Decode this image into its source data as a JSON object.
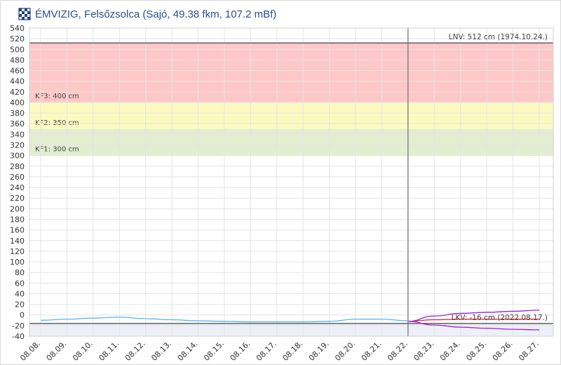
{
  "header": {
    "title": "ÉMVIZIG, Felsőzsolca (Sajó, 49.38 fkm, 107.2 mBf)",
    "logo_icon": "checkered-shield-icon"
  },
  "colors": {
    "kf3_band": "#ffc8c8",
    "kf2_band": "#fdfac0",
    "kf1_band": "#e3eed0",
    "below_lkv_band": "#eef0f8",
    "observed_line": "#5ab4ea",
    "forecast_line": "#9b1fe0",
    "forecast_center": "#cc2233",
    "reference_line": "#555555",
    "grid": "#e4e4e4"
  },
  "chart_data": {
    "type": "line",
    "title": "ÉMVIZIG, Felsőzsolca (Sajó, 49.38 fkm, 107.2 mBf)",
    "xlabel": "",
    "ylabel": "",
    "ylim": [
      -40,
      540
    ],
    "y_ticks": [
      -40,
      -20,
      0,
      20,
      40,
      60,
      80,
      100,
      120,
      140,
      160,
      180,
      200,
      220,
      240,
      260,
      280,
      300,
      320,
      340,
      360,
      380,
      400,
      420,
      440,
      460,
      480,
      500,
      520,
      540
    ],
    "y_tick_labels": [
      "-40",
      "-20",
      "0",
      "20",
      "40",
      "60",
      "80",
      "100",
      "120",
      "140",
      "160",
      "180",
      "200",
      "220",
      "240",
      "260",
      "280",
      "300",
      "320",
      "340",
      "360",
      "380",
      "400",
      "420",
      "440",
      "460",
      "480",
      "500",
      "520",
      "540"
    ],
    "x_labels": [
      "08.08.",
      "08.09.",
      "08.10.",
      "08.11.",
      "08.12.",
      "08.13.",
      "08.14.",
      "08.15.",
      "08.16.",
      "08.17.",
      "08.18.",
      "08.19.",
      "08.20.",
      "08.21.",
      "08.22.",
      "08.23.",
      "08.24.",
      "08.25.",
      "08.26.",
      "08.27."
    ],
    "grid": true,
    "bands": [
      {
        "name": "KF3",
        "label": "KF3: 400 cm",
        "from": 400,
        "to": 512
      },
      {
        "name": "KF2",
        "label": "KF2: 350 cm",
        "from": 350,
        "to": 400
      },
      {
        "name": "KF1",
        "label": "KF1: 300 cm",
        "from": 300,
        "to": 350
      }
    ],
    "reference_lines": [
      {
        "label": "LNV: 512 cm (1974.10.24.)",
        "value": 512
      },
      {
        "label": "LKV: -16 cm (2022.08.17.)",
        "value": -16
      }
    ],
    "now_marker": "08.22.",
    "series": [
      {
        "kind": "observed",
        "x": [
          "08.08.",
          "08.09.",
          "08.10.",
          "08.11.",
          "08.12.",
          "08.13.",
          "08.14.",
          "08.15.",
          "08.16.",
          "08.17.",
          "08.18.",
          "08.19.",
          "08.20.",
          "08.21.",
          "08.22."
        ],
        "values": [
          -10,
          -8,
          -6,
          -4,
          -7,
          -9,
          -11,
          -12,
          -13,
          -13,
          -13,
          -12,
          -8,
          -8,
          -11
        ]
      },
      {
        "kind": "forecast-upper",
        "x": [
          "08.22.",
          "08.23.",
          "08.24.",
          "08.25.",
          "08.26.",
          "08.27."
        ],
        "values": [
          -12,
          -2,
          3,
          5,
          7,
          9
        ]
      },
      {
        "kind": "forecast-center",
        "x": [
          "08.22.",
          "08.23.",
          "08.24.",
          "08.25.",
          "08.26.",
          "08.27."
        ],
        "values": [
          -12,
          -9,
          -8,
          -8,
          -8,
          -8
        ]
      },
      {
        "kind": "forecast-lower",
        "x": [
          "08.22.",
          "08.23.",
          "08.24.",
          "08.25.",
          "08.26.",
          "08.27."
        ],
        "values": [
          -12,
          -19,
          -23,
          -25,
          -27,
          -28
        ]
      }
    ]
  }
}
